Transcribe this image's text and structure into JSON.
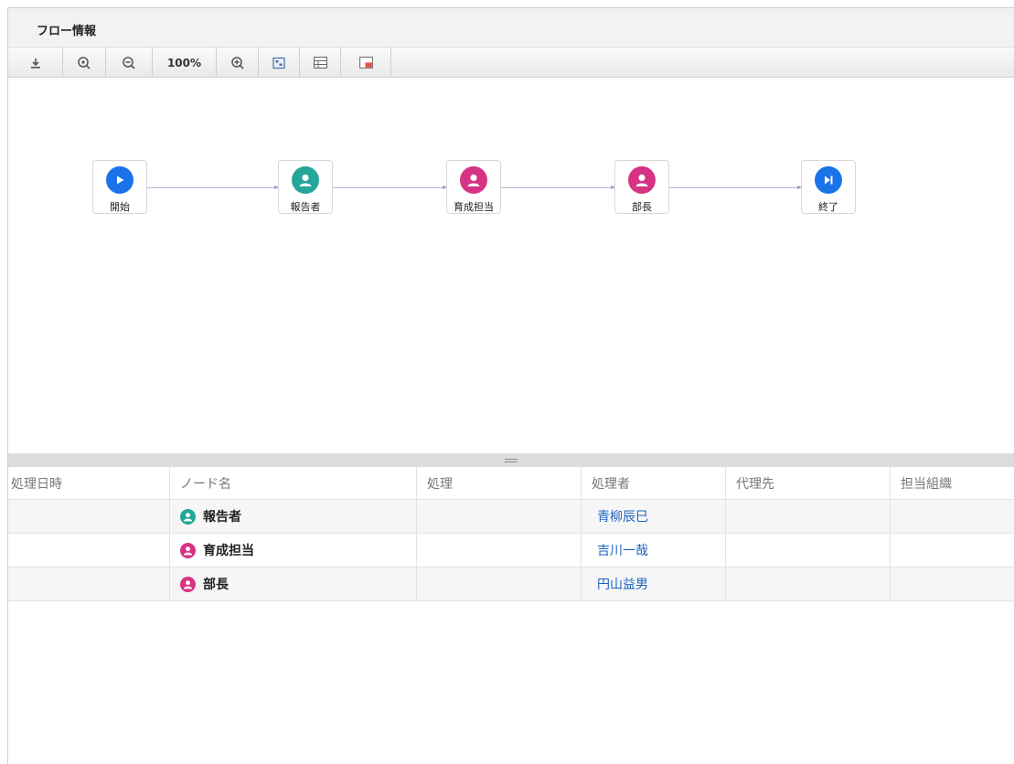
{
  "panel": {
    "title": "フロー情報"
  },
  "toolbar": {
    "zoom_label": "100%",
    "buttons": [
      "download-icon",
      "zoom-fit-icon",
      "zoom-out-icon",
      "zoom-level",
      "zoom-in-icon",
      "fit-window-icon",
      "table-view-icon",
      "window-icon"
    ]
  },
  "flow": {
    "nodes": [
      {
        "label": "開始",
        "icon": "play-icon",
        "color": "#1a73e8"
      },
      {
        "label": "報告者",
        "icon": "user-icon",
        "color": "#26a69a"
      },
      {
        "label": "育成担当",
        "icon": "user-icon",
        "color": "#d63384"
      },
      {
        "label": "部長",
        "icon": "user-icon",
        "color": "#d63384"
      },
      {
        "label": "終了",
        "icon": "skip-end-icon",
        "color": "#1a73e8"
      }
    ],
    "edge_color": "#9b98c6"
  },
  "table": {
    "headers": [
      "処理日時",
      "ノード名",
      "処理",
      "処理者",
      "代理先",
      "担当組織"
    ],
    "rows": [
      {
        "datetime": "",
        "node": "報告者",
        "node_color": "#26a69a",
        "action": "",
        "handler": "青柳辰巳",
        "proxy": "",
        "org": ""
      },
      {
        "datetime": "",
        "node": "育成担当",
        "node_color": "#d63384",
        "action": "",
        "handler": "吉川一哉",
        "proxy": "",
        "org": ""
      },
      {
        "datetime": "",
        "node": "部長",
        "node_color": "#d63384",
        "action": "",
        "handler": "円山益男",
        "proxy": "",
        "org": ""
      }
    ]
  }
}
